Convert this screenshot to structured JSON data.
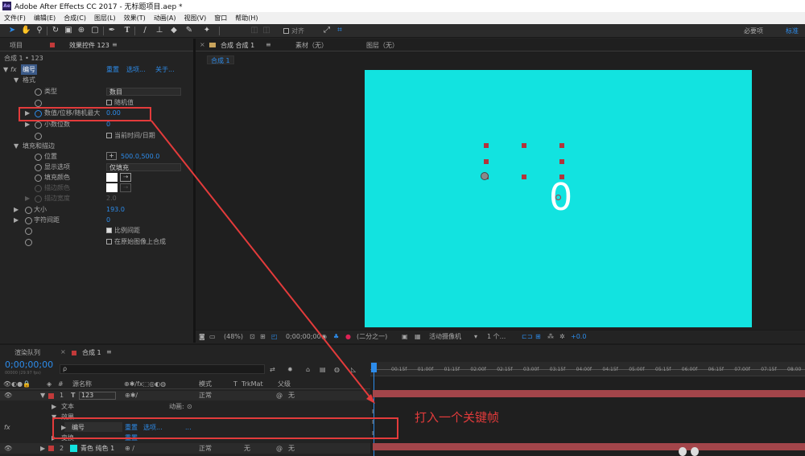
{
  "window": {
    "title": "Adobe After Effects CC 2017 - 无标题项目.aep *",
    "logo": "Ae"
  },
  "menu": [
    "文件(F)",
    "编辑(E)",
    "合成(C)",
    "图层(L)",
    "效果(T)",
    "动画(A)",
    "视图(V)",
    "窗口",
    "帮助(H)"
  ],
  "toolbar": {
    "align_label": "对齐",
    "workspace_tabs": [
      "必要项",
      "标准"
    ]
  },
  "left_panel": {
    "tab_project": "项目",
    "tab_effect": "效果控件 123",
    "comp_path": "合成 1 • 123",
    "effect_name": "编号",
    "reset": "重置",
    "options": "选项...",
    "about": "关于...",
    "format": "格式",
    "type_label": "类型",
    "type_value": "数目",
    "random_label": "随机值",
    "value_label": "数值/位移/随机最大",
    "value_value": "0.00",
    "decimals_label": "小数位数",
    "decimals_value": "0",
    "current_time_label": "当前时间/日期",
    "fill_stroke": "填充和描边",
    "position_label": "位置",
    "position_value": "500.0,500.0",
    "display_label": "显示选项",
    "display_value": "仅填充",
    "fill_color_label": "填充颜色",
    "stroke_color_label": "描边颜色",
    "stroke_width_label": "描边宽度",
    "stroke_width_value": "2.0",
    "size_label": "大小",
    "size_value": "193.0",
    "tracking_label": "字符间距",
    "tracking_value": "0",
    "proportional_label": "比例间距",
    "composite_label": "在原始图像上合成"
  },
  "viewer": {
    "tab_comp": "合成 合成 1",
    "tab_footage": "素材（无）",
    "tab_layer": "图层（无）",
    "comp_chip": "合成 1",
    "canvas_text": "0",
    "zoom": "(48%)",
    "timecode": "0;00;00;00",
    "resolution": "(二分之一)",
    "camera": "活动摄像机",
    "views": "1 个...",
    "exposure": "+0.0",
    "canvas_color": "#12e3e0"
  },
  "timeline": {
    "tab_render": "渲染队列",
    "tab_comp": "合成 1",
    "timecode": "0;00;00;00",
    "fps": "00000 (29.97 fps)",
    "search_placeholder": "ρ",
    "col_source": "源名称",
    "col_mode": "模式",
    "col_t": "T",
    "col_trkmat": "TrkMat",
    "col_parent": "父级",
    "ruler": [
      "00:15f",
      "01:00f",
      "01:15f",
      "02:00f",
      "02:15f",
      "03:00f",
      "03:15f",
      "04:00f",
      "04:15f",
      "05:00f",
      "05:15f",
      "06:00f",
      "06:15f",
      "07:00f",
      "07:15f",
      "08:00"
    ],
    "layer1": {
      "num": "1",
      "type": "T",
      "name": "123",
      "mode": "正常",
      "parent": "无"
    },
    "text_prop": "文本",
    "animate": "动画:",
    "effects_prop": "效果",
    "effect_row": "编号",
    "effect_reset": "重置",
    "effect_options": "选项...",
    "effect_dots": "...",
    "transform_prop": "变换",
    "transform_reset": "重置",
    "layer2": {
      "num": "2",
      "name": "青色 纯色 1",
      "mode": "正常",
      "trkmat": "无",
      "parent": "无"
    },
    "fx_label": "fx"
  },
  "annotation": {
    "text": "打入一个关键帧",
    "color": "#e33b3b"
  }
}
